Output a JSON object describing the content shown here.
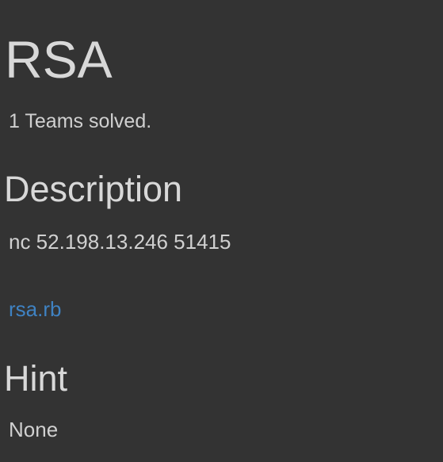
{
  "challenge": {
    "title": "RSA",
    "solved_text": "1 Teams solved."
  },
  "description": {
    "heading": "Description",
    "text": "nc 52.198.13.246 51415",
    "file_link": "rsa.rb"
  },
  "hint": {
    "heading": "Hint",
    "text": "None"
  },
  "colors": {
    "background": "#333333",
    "text": "#d0d0d0",
    "link": "#3f82c2"
  }
}
